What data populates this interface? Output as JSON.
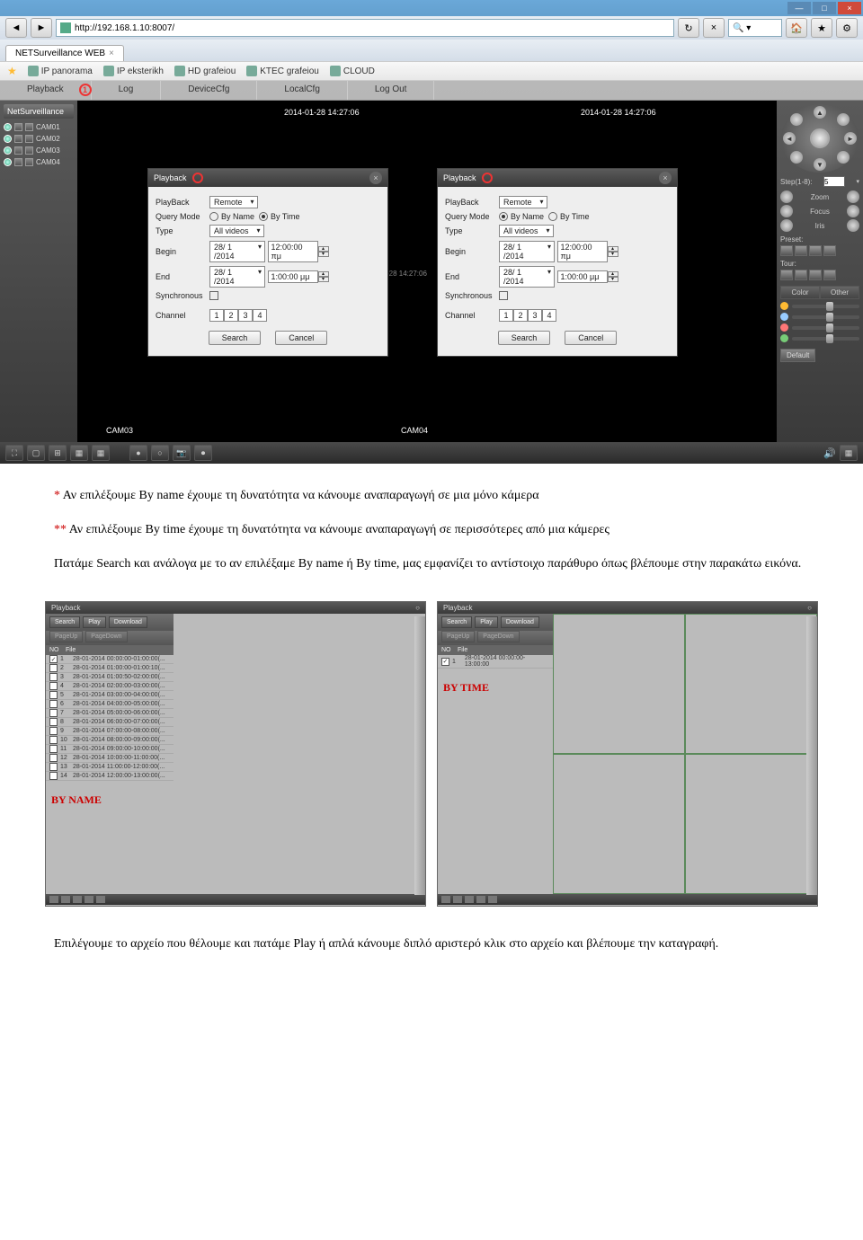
{
  "browser": {
    "url": "http://192.168.1.10:8007/",
    "tab_title": "NETSurveillance WEB",
    "favorites": [
      "IP panorama",
      "IP eksterikh",
      "HD grafeiou",
      "KTEC grafeiou",
      "CLOUD"
    ]
  },
  "menu": {
    "items": [
      "Playback",
      "Log",
      "DeviceCfg",
      "LocalCfg",
      "Log Out"
    ],
    "marker_number": "1"
  },
  "leftpanel": {
    "title": "NetSurveillance",
    "cams": [
      "CAM01",
      "CAM02",
      "CAM03",
      "CAM04"
    ]
  },
  "viewarea": {
    "ts1": "2014-01-28 14:27:06",
    "ts2": "2014-01-28 14:27:06",
    "foot1": "CAM03",
    "foot2": "CAM04",
    "mid1": "-28 14:27:06",
    "mid2": "14:27:06"
  },
  "rightpanel": {
    "step_label": "Step(1-8):",
    "step_value": "5",
    "zoom": "Zoom",
    "focus": "Focus",
    "iris": "Iris",
    "preset": "Preset:",
    "tour": "Tour:",
    "color_tab": "Color",
    "other_tab": "Other",
    "default_btn": "Default"
  },
  "dialogs": {
    "title": "Playback",
    "labels": {
      "playback": "PlayBack",
      "query_mode": "Query Mode",
      "type": "Type",
      "begin": "Begin",
      "end": "End",
      "synchronous": "Synchronous",
      "channel": "Channel"
    },
    "remote": "Remote",
    "by_name": "By Name",
    "by_time": "By Time",
    "all_videos": "All videos",
    "search_btn": "Search",
    "cancel_btn": "Cancel",
    "channels": [
      "1",
      "2",
      "3",
      "4"
    ],
    "left": {
      "begin_date": "28/ 1 /2014",
      "begin_time": "12:00:00 πμ",
      "end_date": "28/ 1 /2014",
      "end_time": "1:00:00 μμ"
    },
    "right": {
      "begin_date": "28/ 1 /2014",
      "begin_time": "12:00:00 πμ",
      "end_date": "28/ 1 /2014",
      "end_time": "1:00:00 μμ"
    }
  },
  "doc": {
    "p1a": "* ",
    "p1b": "Αν επιλέξουμε By name έχουμε τη δυνατότητα να κάνουμε αναπαραγωγή σε μια μόνο κάμερα",
    "p2a": "** ",
    "p2b": "Αν επιλέξουμε By time έχουμε τη δυνατότητα να κάνουμε αναπαραγωγή σε περισσότερες από μια κάμερες",
    "p3": "Πατάμε Search και ανάλογα με το αν επιλέξαμε By name ή By time, μας εμφανίζει το αντίστοιχο παράθυρο όπως βλέπουμε στην παρακάτω εικόνα.",
    "p4": "Επιλέγουμε το αρχείο που θέλουμε και πατάμε Play ή απλά κάνουμε διπλό αριστερό κλικ στο αρχείο και βλέπουμε την καταγραφή."
  },
  "playback2": {
    "title": "Playback",
    "buttons": {
      "search": "Search",
      "play": "Play",
      "download": "Download",
      "pageup": "PageUp",
      "pagedown": "PageDown"
    },
    "headers": {
      "no": "NO",
      "file": "File"
    },
    "by_name_label": "BY NAME",
    "by_time_label": "BY TIME",
    "left_files": [
      {
        "no": "1",
        "name": "28-01-2014 00:00:00-01:00:00(...",
        "ck": true
      },
      {
        "no": "2",
        "name": "28-01-2014 01:00:00-01:00:10(...",
        "ck": false
      },
      {
        "no": "3",
        "name": "28-01-2014 01:00:50-02:00:00(...",
        "ck": false
      },
      {
        "no": "4",
        "name": "28-01-2014 02:00:00-03:00:00(...",
        "ck": false
      },
      {
        "no": "5",
        "name": "28-01-2014 03:00:00-04:00:00(...",
        "ck": false
      },
      {
        "no": "6",
        "name": "28-01-2014 04:00:00-05:00:00(...",
        "ck": false
      },
      {
        "no": "7",
        "name": "28-01-2014 05:00:00-06:00:00(...",
        "ck": false
      },
      {
        "no": "8",
        "name": "28-01-2014 06:00:00-07:00:00(...",
        "ck": false
      },
      {
        "no": "9",
        "name": "28-01-2014 07:00:00-08:00:00(...",
        "ck": false
      },
      {
        "no": "10",
        "name": "28-01-2014 08:00:00-09:00:00(...",
        "ck": false
      },
      {
        "no": "11",
        "name": "28-01-2014 09:00:00-10:00:00(...",
        "ck": false
      },
      {
        "no": "12",
        "name": "28-01-2014 10:00:00-11:00:00(...",
        "ck": false
      },
      {
        "no": "13",
        "name": "28-01-2014 11:00:00-12:00:00(...",
        "ck": false
      },
      {
        "no": "14",
        "name": "28-01-2014 12:00:00-13:00:00(...",
        "ck": false
      }
    ],
    "right_files": [
      {
        "no": "1",
        "name": "28-01-2014 00:00:00-13:00:00",
        "ck": true
      }
    ]
  }
}
